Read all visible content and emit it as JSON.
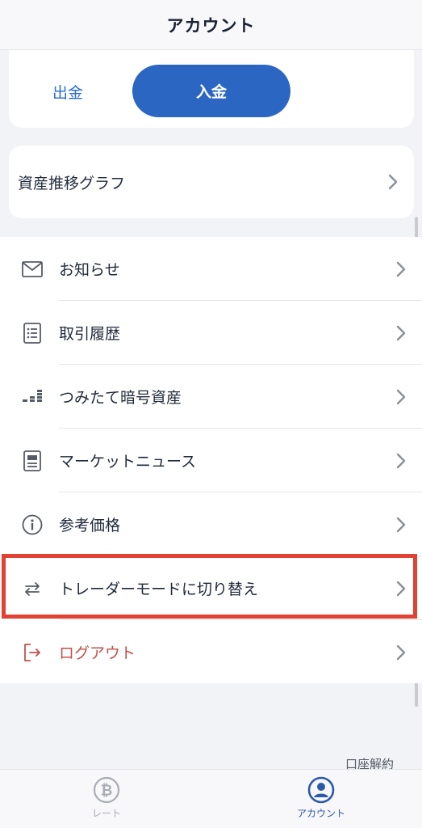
{
  "header": {
    "title": "アカウント"
  },
  "funds": {
    "withdraw_label": "出金",
    "deposit_label": "入金"
  },
  "asset_graph": {
    "label": "資産推移グラフ"
  },
  "menu": {
    "items": [
      {
        "label": "お知らせ",
        "icon": "mail-icon"
      },
      {
        "label": "取引履歴",
        "icon": "list-document-icon"
      },
      {
        "label": "つみたて暗号資産",
        "icon": "stacked-bars-icon"
      },
      {
        "label": "マーケットニュース",
        "icon": "newspaper-icon"
      },
      {
        "label": "参考価格",
        "icon": "info-icon"
      },
      {
        "label": "トレーダーモードに切り替え",
        "icon": "swap-arrows-icon"
      },
      {
        "label": "ログアウト",
        "icon": "logout-icon"
      }
    ]
  },
  "footer": {
    "close_account": "口座解約"
  },
  "tabbar": {
    "tabs": [
      {
        "label": "レート",
        "icon": "bitcoin-icon",
        "active": false
      },
      {
        "label": "アカウント",
        "icon": "user-icon",
        "active": true
      }
    ]
  },
  "colors": {
    "primary": "#2b66c3",
    "highlight": "#e04234",
    "logout": "#c0504d",
    "background": "#f2f3f6"
  }
}
